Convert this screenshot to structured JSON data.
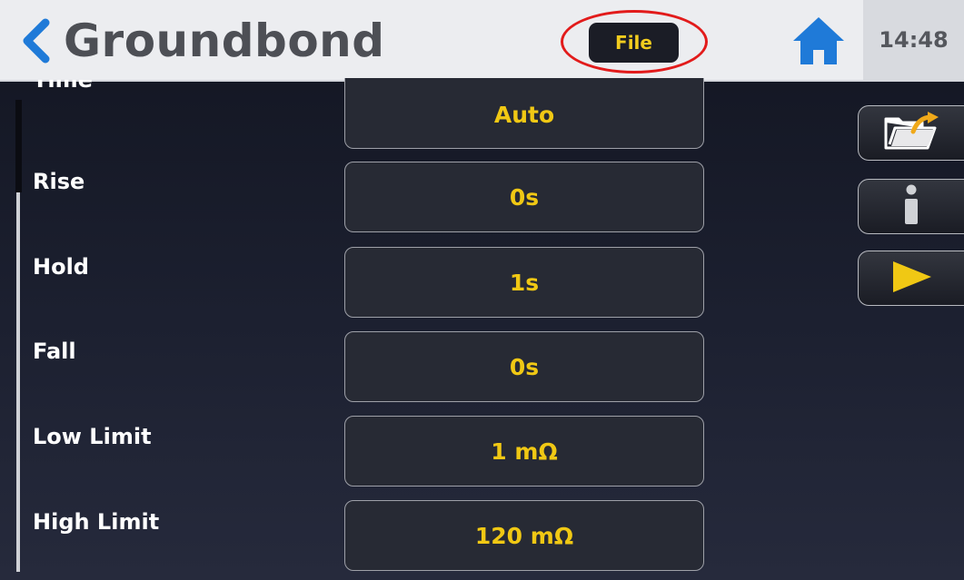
{
  "header": {
    "title": "Groundbond",
    "file_label": "File",
    "clock": "14:48"
  },
  "params": [
    {
      "label": "Time",
      "value": "Auto"
    },
    {
      "label": "Rise",
      "value": "0s"
    },
    {
      "label": "Hold",
      "value": "1s"
    },
    {
      "label": "Fall",
      "value": "0s"
    },
    {
      "label": "Low Limit",
      "value": "1 mΩ"
    },
    {
      "label": "High Limit",
      "value": "120 mΩ"
    }
  ],
  "side_buttons": [
    "open-folder-icon",
    "info-icon",
    "play-icon"
  ],
  "colors": {
    "accent_blue": "#1f7ad8",
    "value_yellow": "#f0c814",
    "highlight_red": "#e21b1b"
  }
}
